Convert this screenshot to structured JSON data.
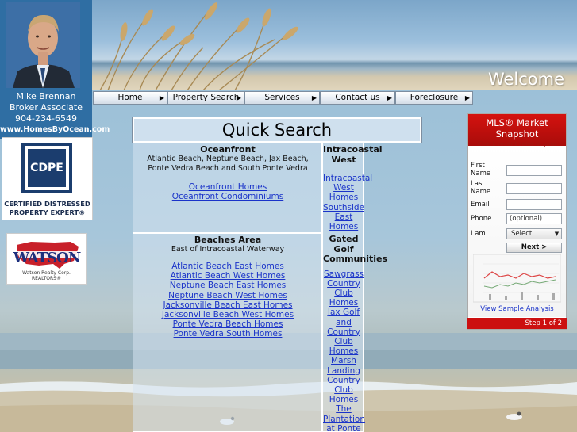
{
  "banner": {
    "welcome": "Welcome"
  },
  "agent": {
    "name": "Mike Brennan",
    "title": "Broker Associate",
    "phone": "904-234-6549",
    "website": "www.HomesByOcean.com"
  },
  "badges": {
    "cdpe_logo": "CDPE",
    "cdpe_line1": "CERTIFIED DISTRESSED",
    "cdpe_line2": "PROPERTY EXPERT®",
    "watson_logo": "WATSON",
    "watson_sub": "Watson Realty Corp. REALTORS®"
  },
  "nav": {
    "items": [
      {
        "label": "Home"
      },
      {
        "label": "Property Search"
      },
      {
        "label": "Services"
      },
      {
        "label": "Contact us"
      },
      {
        "label": "Foreclosure"
      }
    ]
  },
  "quick_search": {
    "title": "Quick Search",
    "oceanfront": {
      "heading": "Oceanfront",
      "sub1": "Atlantic Beach, Neptune Beach, Jax Beach,",
      "sub2": "Ponte Vedra Beach and South Ponte Vedra",
      "links": [
        "Oceanfront Homes",
        "Oceanfront Condominiums"
      ]
    },
    "intracoastal": {
      "heading1": "Intracoastal",
      "heading2": "West",
      "links": [
        "Intracoastal",
        "West",
        "Homes",
        "Southside",
        "East",
        "Homes"
      ]
    },
    "beaches": {
      "heading": "Beaches Area",
      "sub": "East of Intracoastal Waterway",
      "links": [
        "Atlantic Beach East Homes",
        "Atlantic Beach West Homes",
        "Neptune Beach East Homes",
        "Neptune Beach West Homes",
        "Jacksonville Beach East Homes",
        "Jacksonville Beach West Homes",
        "Ponte Vedra Beach Homes",
        "Ponte Vedra South Homes"
      ]
    },
    "golf": {
      "heading1": "Gated",
      "heading2": "Golf",
      "heading3": "Communities",
      "links": [
        "Sawgrass",
        "Country",
        "Club",
        "Homes",
        "Jax Golf",
        "and",
        "Country",
        "Club",
        "Homes",
        "Marsh",
        "Landing",
        "Country",
        "Club",
        "Homes",
        "The",
        "Plantation",
        "at Ponte"
      ]
    }
  },
  "mls": {
    "title1": "MLS® Market",
    "title2": "Snapshot",
    "subtitle": "Check recent sales in your",
    "first_name_label1": "First",
    "first_name_label2": "Name",
    "last_name_label1": "Last",
    "last_name_label2": "Name",
    "email_label": "Email",
    "phone_label": "Phone",
    "phone_placeholder": "(optional)",
    "iam_label": "I am",
    "iam_value": "Select",
    "next_label": "Next >",
    "analysis_link": "View Sample Analysis",
    "step": "Step 1 of 2"
  }
}
